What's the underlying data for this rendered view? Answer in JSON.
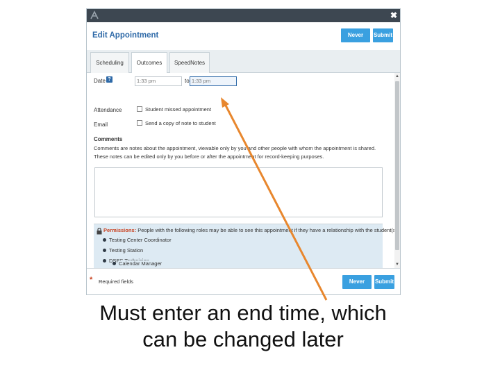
{
  "dialog": {
    "title": "Edit Appointment",
    "never_mind_label": "Never Mind",
    "submit_label": "Submit"
  },
  "tabs": [
    {
      "label": "Scheduling"
    },
    {
      "label": "Outcomes"
    },
    {
      "label": "SpeedNotes"
    }
  ],
  "form": {
    "date_label": "Date",
    "start_time": "1:33 pm",
    "to_label": "to",
    "end_time": "1:33 pm",
    "attendance_label": "Attendance",
    "attendance_checkbox": "Student missed appointment",
    "email_label": "Email",
    "email_checkbox": "Send a copy of note to student",
    "comments_label": "Comments",
    "comments_description": "Comments are notes about the appointment, viewable only by you and other people with whom the appointment is shared. These notes can be edited only by you before or after the appointment for record-keeping purposes."
  },
  "permissions": {
    "heading": "Permissions:",
    "text": "People with the following roles may be able to see this appointment if they have a relationship with the student(s):",
    "roles": [
      "Testing Center Coordinator",
      "Testing Station",
      "DSPS Technician",
      "Calendar Manager"
    ]
  },
  "footer": {
    "required_star": "*",
    "required_text": "Required fields"
  },
  "caption": {
    "line1": "Must enter an end time, which",
    "line2": "can be changed later"
  },
  "colors": {
    "accent": "#3aa0e0",
    "titlebar": "#3d4751",
    "arrow": "#e8872e",
    "permission_bg": "#ddeaf3"
  }
}
